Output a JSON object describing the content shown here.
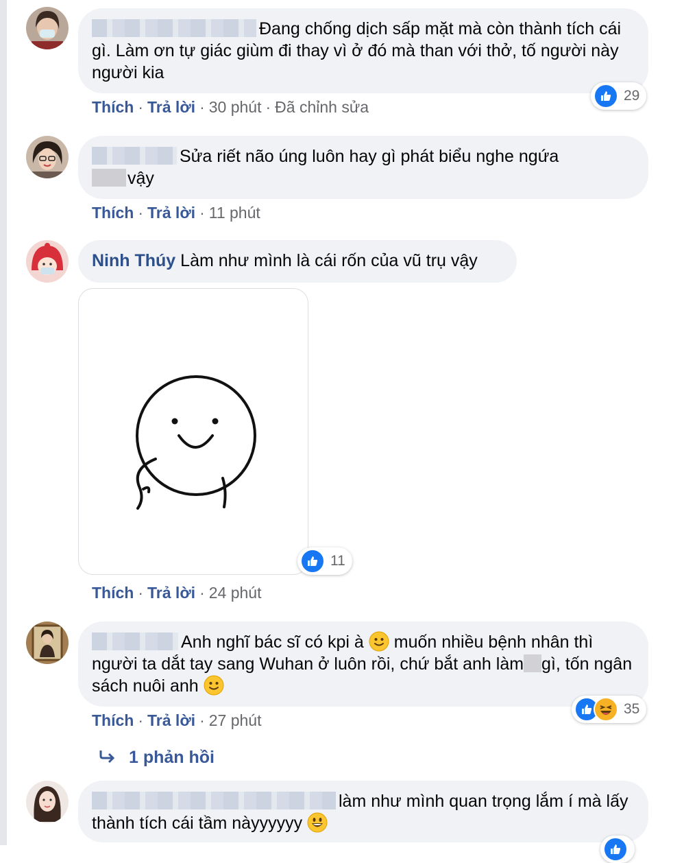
{
  "comments": [
    {
      "text": "Đang chống dịch sấp mặt mà còn thành tích cái gì. Làm ơn tự giác giùm đi thay vì ở đó mà than với thở, tố người này người kia",
      "reactions": "29",
      "actions": {
        "like": "Thích",
        "reply": "Trả lời",
        "time": "30 phút",
        "edited": "Đã chỉnh sửa"
      }
    },
    {
      "text": "Sửa riết não úng luôn hay gì phát biểu nghe ngứa",
      "text_end": "vậy",
      "actions": {
        "like": "Thích",
        "reply": "Trả lời",
        "time": "11 phút"
      }
    },
    {
      "author": "Ninh Thúy",
      "text": "Làm như mình là cái rốn của vũ trụ vậy",
      "reactions": "11",
      "actions": {
        "like": "Thích",
        "reply": "Trả lời",
        "time": "24 phút"
      }
    },
    {
      "text_a": "Anh nghĩ bác sĩ có kpi à",
      "text_b": "muốn nhiều bệnh nhân thì người ta dắt tay sang Wuhan ở luôn rồi, chứ bắt anh làm",
      "text_c": "gì, tốn ngân sách nuôi anh",
      "reactions": "35",
      "actions": {
        "like": "Thích",
        "reply": "Trả lời",
        "time": "27 phút"
      },
      "replies_link": "1 phản hồi"
    },
    {
      "text": "làm như mình quan trọng lắm í mà lấy thành tích cái tầm nàyyyyyy"
    }
  ],
  "icons": {
    "like": "like-icon",
    "haha": "haha-icon",
    "reply_arrow": "reply-arrow-icon",
    "smile": "slightly-smiling-emoji",
    "grin": "grinning-emoji"
  },
  "colors": {
    "bubble": "#f0f2f5",
    "link": "#385898",
    "author": "#2d4f8b",
    "muted": "#65676b",
    "like_blue": "#1877f2",
    "haha_yellow": "#f7b125"
  }
}
